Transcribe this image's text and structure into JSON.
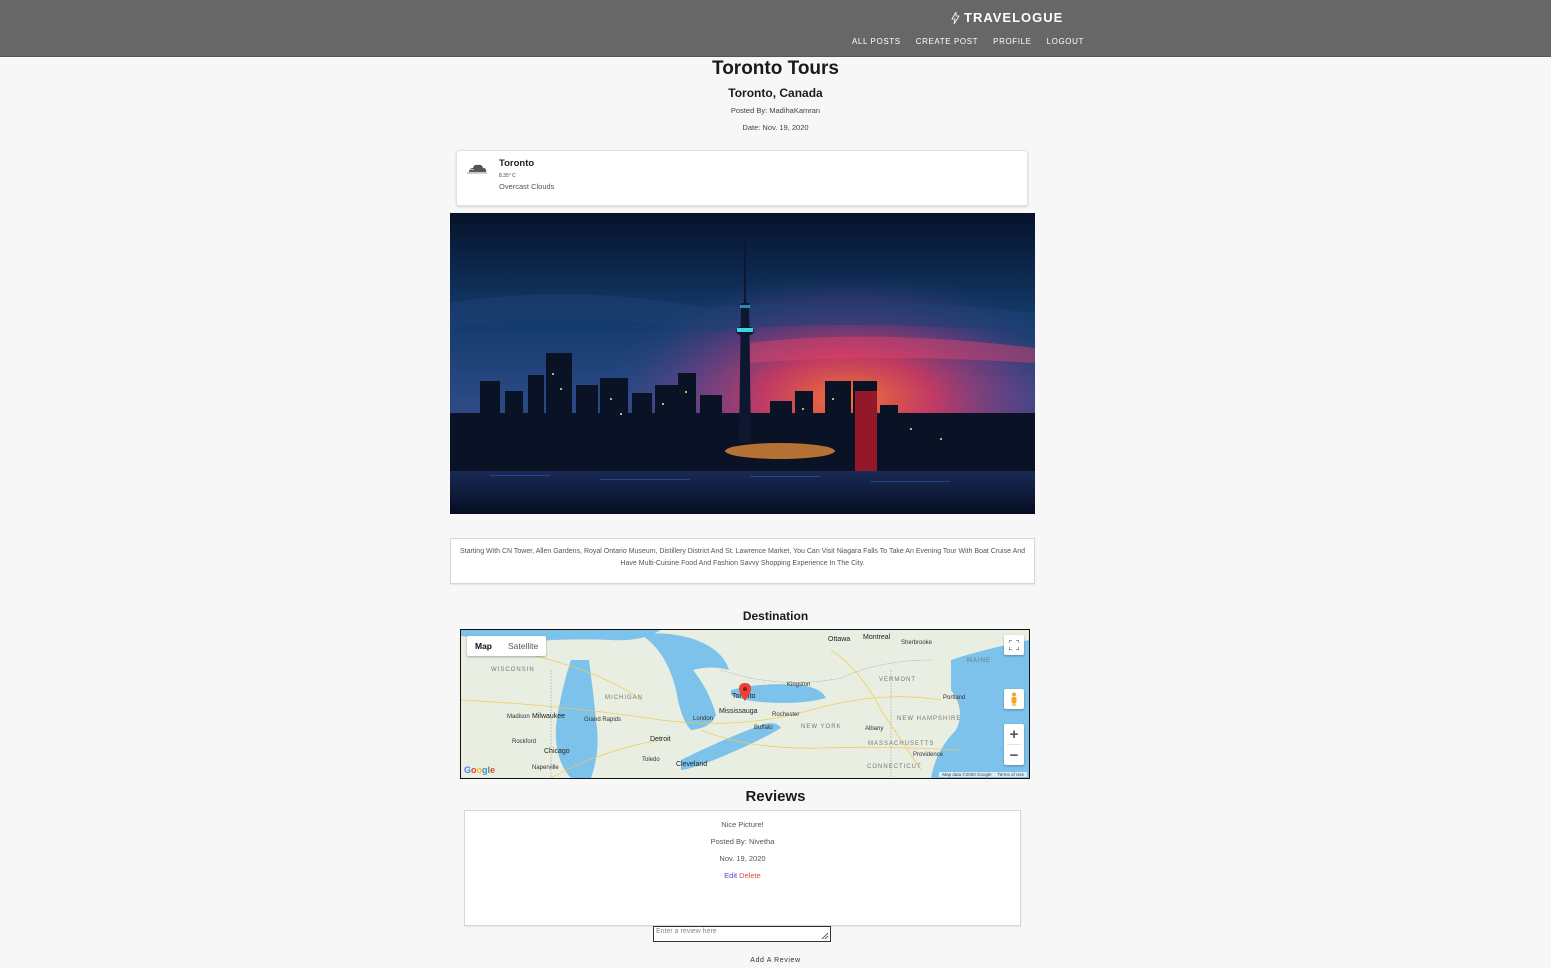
{
  "header": {
    "brand": "TRAVELOGUE",
    "nav": [
      "ALL POSTS",
      "CREATE POST",
      "PROFILE",
      "LOGOUT"
    ]
  },
  "post": {
    "title": "Toronto Tours",
    "location": "Toronto, Canada",
    "author": "Posted By: MadihaKamran",
    "date": "Date: Nov. 19, 2020",
    "description": "Starting With CN Tower, Allen Gardens, Royal Ontario Museum, Distillery District And St. Lawrence Market, You Can Visit Niagara Falls To Take An Evening Tour With Boat Cruise And Have Multi-Cuisine Food And Fashion Savvy Shopping Experience In The City."
  },
  "weather": {
    "city": "Toronto",
    "temperature": "8.35° C",
    "condition": "Overcast Clouds",
    "icon": "cloud-icon"
  },
  "destination": {
    "heading": "Destination",
    "map_type_options": [
      "Map",
      "Satellite"
    ],
    "map_type_selected": "Map",
    "attribution": "Map data ©2020 Google",
    "terms": "Terms of Use",
    "logo": "Google",
    "labels": {
      "ottawa": "Ottawa",
      "montreal": "Montreal",
      "sherbrooke": "Sherbrooke",
      "toronto": "Toronto",
      "mississauga": "Mississauga",
      "kingston": "Kingston",
      "rochester": "Rochester",
      "buffalo": "Buffalo",
      "london": "London",
      "detroit": "Detroit",
      "toledo": "Toledo",
      "cleveland": "Cleveland",
      "chicago": "Chicago",
      "milwaukee": "Milwaukee",
      "madison": "Madison",
      "rockford": "Rockford",
      "grand_rapids": "Grand Rapids",
      "naperville": "Naperville",
      "albany": "Albany",
      "providence": "Providence",
      "portland": "Portland",
      "wisconsin": "WISCONSIN",
      "michigan": "MICHIGAN",
      "new_york": "NEW YORK",
      "vermont": "VERMONT",
      "maine": "MAINE",
      "new_hampshire": "NEW HAMPSHIRE",
      "massachusetts": "MASSACHUSETTS",
      "connecticut": "CONNECTICUT"
    }
  },
  "reviews": {
    "heading": "Reviews",
    "items": [
      {
        "text": "Nice Picture!",
        "author": "Posted By: Nivetha",
        "date": "Nov. 19, 2020",
        "edit_label": "Edit",
        "delete_label": "Delete"
      }
    ],
    "input_placeholder": "Enter a review here",
    "submit_label": "Add A Review"
  },
  "colors": {
    "header_bg": "#676767",
    "page_bg": "#f7f7f7",
    "edit_link": "#4a4ad0",
    "delete_link": "#e04848",
    "map_pin": "#ea4335"
  }
}
